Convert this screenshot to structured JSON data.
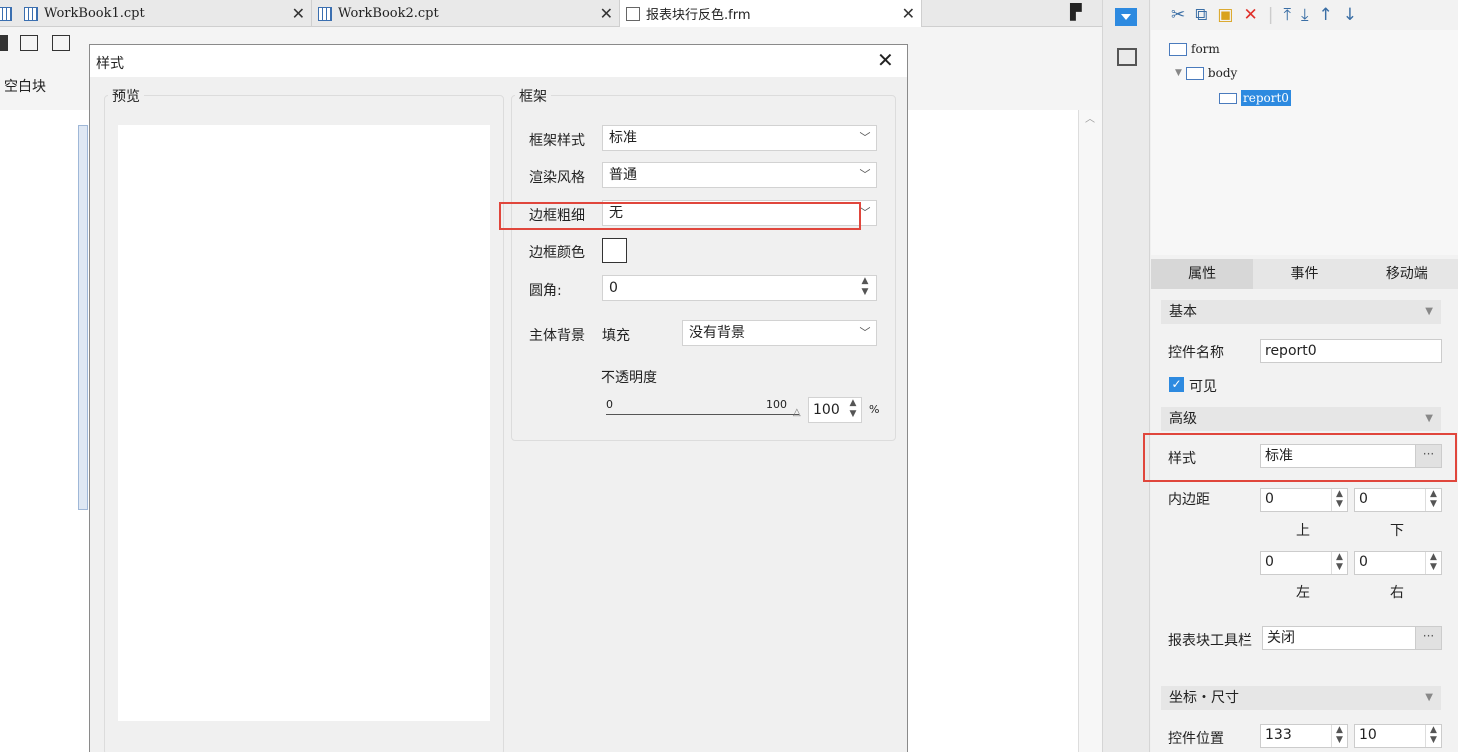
{
  "tabs": [
    {
      "label": "WorkBook1.cpt"
    },
    {
      "label": "WorkBook2.cpt"
    },
    {
      "label": "报表块行反色.frm"
    }
  ],
  "toolbar": {
    "blank_block_label": "空白块"
  },
  "dialog": {
    "title": "样式",
    "preview_label": "预览",
    "frame_label": "框架",
    "frame_style_label": "框架样式",
    "frame_style_value": "标准",
    "render_style_label": "渲染风格",
    "render_style_value": "普通",
    "border_width_label": "边框粗细",
    "border_width_value": "无",
    "border_color_label": "边框颜色",
    "corner_label": "圆角:",
    "corner_value": "0",
    "bg_label": "主体背景",
    "fill_label": "填充",
    "fill_value": "没有背景",
    "opacity_label": "不透明度",
    "opacity_min": "0",
    "opacity_max": "100",
    "opacity_value": "100",
    "opacity_unit": "%"
  },
  "tree": {
    "root": "form",
    "body": "body",
    "report": "report0"
  },
  "right_tabs": [
    "属性",
    "事件",
    "移动端"
  ],
  "props": {
    "basic_section": "基本",
    "name_label": "控件名称",
    "name_value": "report0",
    "visible_label": "可见",
    "advanced_section": "高级",
    "style_label": "样式",
    "style_value": "标准",
    "dots": "···",
    "padding_label": "内边距",
    "pad_top": "0",
    "pad_bottom": "0",
    "pad_left": "0",
    "pad_right": "0",
    "top_label": "上",
    "bottom_label": "下",
    "left_label": "左",
    "right_label": "右",
    "report_toolbar_label": "报表块工具栏",
    "report_toolbar_value": "关闭",
    "coord_section": "坐标・尺寸",
    "position_label": "控件位置",
    "pos_x": "133",
    "pos_y": "10"
  }
}
